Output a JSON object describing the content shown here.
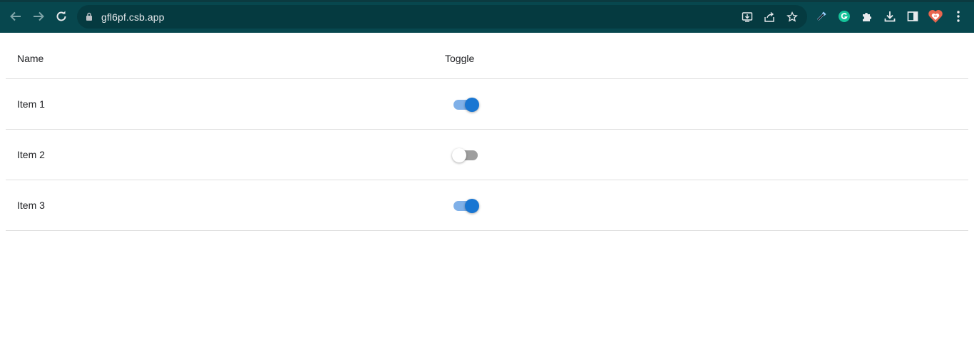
{
  "browser": {
    "url": "gfl6pf.csb.app",
    "colors": {
      "toolbar": "#07474e",
      "omnibox": "#053a40",
      "icon": "#e8eaed"
    }
  },
  "table": {
    "headers": {
      "name": "Name",
      "toggle": "Toggle"
    },
    "rows": [
      {
        "name": "Item 1",
        "toggle_on": true
      },
      {
        "name": "Item 2",
        "toggle_on": false
      },
      {
        "name": "Item 3",
        "toggle_on": true
      }
    ]
  },
  "colors": {
    "switch_on": "#1976d2",
    "switch_on_track": "#7fb0e8",
    "switch_off_track": "#9e9e9e",
    "divider": "#e0e0e0"
  }
}
